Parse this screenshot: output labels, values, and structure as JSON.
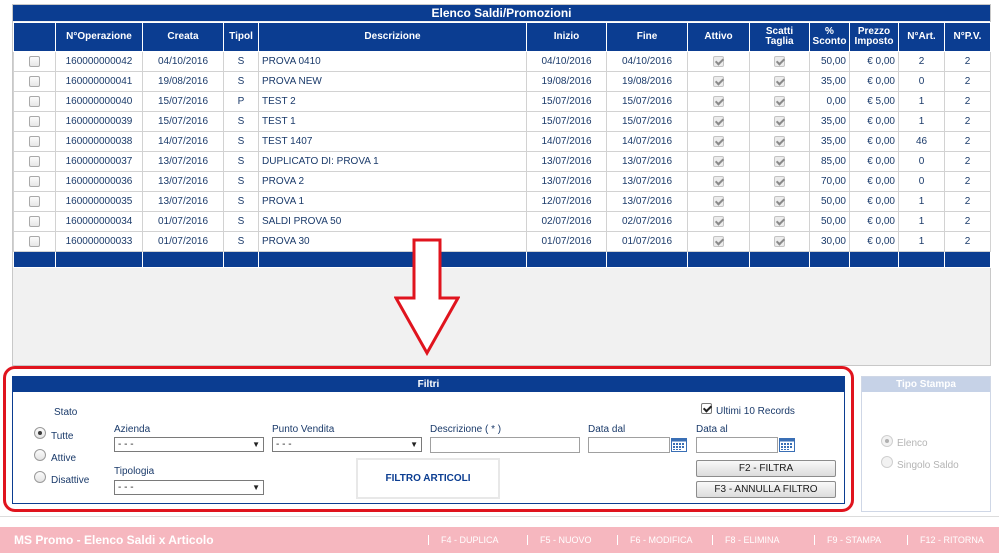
{
  "grid": {
    "title": "Elenco Saldi/Promozioni",
    "columns": [
      "",
      "N°Operazione",
      "Creata",
      "Tipol",
      "Descrizione",
      "Inizio",
      "Fine",
      "Attivo",
      "Scatti Taglia",
      "% Sconto",
      "Prezzo Imposto",
      "N°Art.",
      "N°P.V."
    ],
    "rows": [
      {
        "op": "160000000042",
        "creata": "04/10/2016",
        "tipol": "S",
        "descr": "PROVA 0410",
        "inizio": "04/10/2016",
        "fine": "04/10/2016",
        "sconto": "50,00",
        "prezzo": "€ 0,00",
        "art": "2",
        "pv": "2"
      },
      {
        "op": "160000000041",
        "creata": "19/08/2016",
        "tipol": "S",
        "descr": "PROVA NEW",
        "inizio": "19/08/2016",
        "fine": "19/08/2016",
        "sconto": "35,00",
        "prezzo": "€ 0,00",
        "art": "0",
        "pv": "2"
      },
      {
        "op": "160000000040",
        "creata": "15/07/2016",
        "tipol": "P",
        "descr": "TEST 2",
        "inizio": "15/07/2016",
        "fine": "15/07/2016",
        "sconto": "0,00",
        "prezzo": "€ 5,00",
        "art": "1",
        "pv": "2"
      },
      {
        "op": "160000000039",
        "creata": "15/07/2016",
        "tipol": "S",
        "descr": "TEST 1",
        "inizio": "15/07/2016",
        "fine": "15/07/2016",
        "sconto": "35,00",
        "prezzo": "€ 0,00",
        "art": "1",
        "pv": "2"
      },
      {
        "op": "160000000038",
        "creata": "14/07/2016",
        "tipol": "S",
        "descr": "TEST 1407",
        "inizio": "14/07/2016",
        "fine": "14/07/2016",
        "sconto": "35,00",
        "prezzo": "€ 0,00",
        "art": "46",
        "pv": "2"
      },
      {
        "op": "160000000037",
        "creata": "13/07/2016",
        "tipol": "S",
        "descr": "DUPLICATO DI: PROVA 1",
        "inizio": "13/07/2016",
        "fine": "13/07/2016",
        "sconto": "85,00",
        "prezzo": "€ 0,00",
        "art": "0",
        "pv": "2"
      },
      {
        "op": "160000000036",
        "creata": "13/07/2016",
        "tipol": "S",
        "descr": "PROVA 2",
        "inizio": "13/07/2016",
        "fine": "13/07/2016",
        "sconto": "70,00",
        "prezzo": "€ 0,00",
        "art": "0",
        "pv": "2"
      },
      {
        "op": "160000000035",
        "creata": "13/07/2016",
        "tipol": "S",
        "descr": "PROVA 1",
        "inizio": "12/07/2016",
        "fine": "13/07/2016",
        "sconto": "50,00",
        "prezzo": "€ 0,00",
        "art": "1",
        "pv": "2"
      },
      {
        "op": "160000000034",
        "creata": "01/07/2016",
        "tipol": "S",
        "descr": "SALDI PROVA 50",
        "inizio": "02/07/2016",
        "fine": "02/07/2016",
        "sconto": "50,00",
        "prezzo": "€ 0,00",
        "art": "1",
        "pv": "2"
      },
      {
        "op": "160000000033",
        "creata": "01/07/2016",
        "tipol": "S",
        "descr": "PROVA 30",
        "inizio": "01/07/2016",
        "fine": "01/07/2016",
        "sconto": "30,00",
        "prezzo": "€ 0,00",
        "art": "1",
        "pv": "2"
      }
    ]
  },
  "filters": {
    "title": "Filtri",
    "stato_label": "Stato",
    "stato_options": [
      "Tutte",
      "Attive",
      "Disattive"
    ],
    "azienda_label": "Azienda",
    "azienda_value": "- - -",
    "punto_vendita_label": "Punto Vendita",
    "punto_vendita_value": "- - -",
    "descrizione_label": "Descrizione ( * )",
    "descrizione_value": "",
    "data_dal_label": "Data dal",
    "data_dal_value": "",
    "data_al_label": "Data al",
    "data_al_value": "",
    "tipologia_label": "Tipologia",
    "tipologia_value": "- - -",
    "ultimi_label": "Ultimi 10 Records",
    "filtro_articoli": "FILTRO ARTICOLI",
    "filtra_button": "F2 - FILTRA",
    "annulla_button": "F3 - ANNULLA FILTRO"
  },
  "stampa": {
    "title": "Tipo Stampa",
    "options": [
      "Elenco",
      "Singolo Saldo"
    ]
  },
  "footer": {
    "title": "MS Promo - Elenco Saldi x Articolo",
    "keys": [
      "F4 - DUPLICA",
      "F5 - NUOVO",
      "F6 - MODIFICA",
      "F8 - ELIMINA",
      "F9 - STAMPA",
      "F12 - RITORNA"
    ]
  },
  "colors": {
    "header_blue": "#0b3d91",
    "highlight_red": "#e0141e",
    "footer_pink": "#f6b7bf"
  },
  "icons": {
    "arrow": "down-arrow-icon",
    "calendar": "calendar-icon",
    "dropdown": "triangle-down-icon"
  }
}
